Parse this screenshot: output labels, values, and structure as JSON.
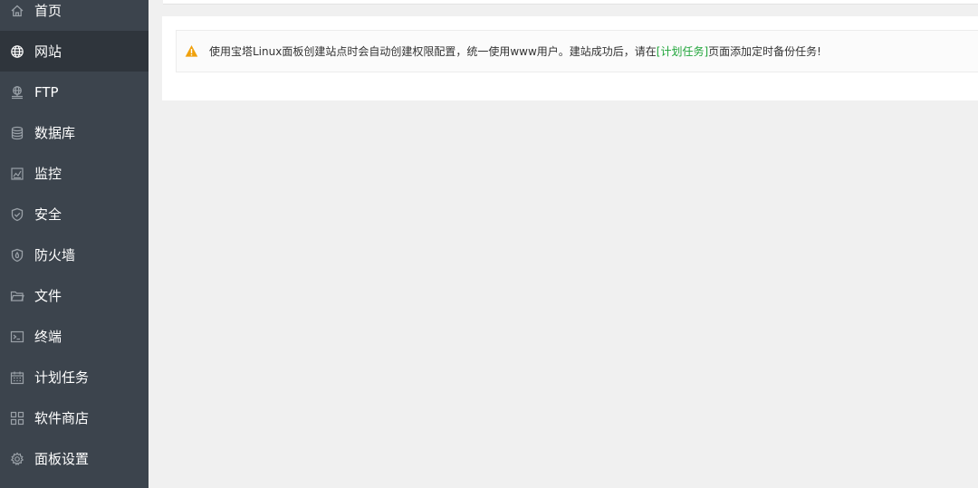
{
  "colors": {
    "sidebar_bg": "#3c444d",
    "sidebar_active_bg": "#2f353c",
    "link_green": "#20a53a",
    "warning_orange": "#f0a10c"
  },
  "sidebar": {
    "items": [
      {
        "label": "首页",
        "icon": "home-icon",
        "active": false
      },
      {
        "label": "网站",
        "icon": "globe-icon",
        "active": true
      },
      {
        "label": "FTP",
        "icon": "ftp-icon",
        "active": false
      },
      {
        "label": "数据库",
        "icon": "database-icon",
        "active": false
      },
      {
        "label": "监控",
        "icon": "monitor-icon",
        "active": false
      },
      {
        "label": "安全",
        "icon": "shield-icon",
        "active": false
      },
      {
        "label": "防火墙",
        "icon": "firewall-icon",
        "active": false
      },
      {
        "label": "文件",
        "icon": "folder-icon",
        "active": false
      },
      {
        "label": "终端",
        "icon": "terminal-icon",
        "active": false
      },
      {
        "label": "计划任务",
        "icon": "calendar-icon",
        "active": false
      },
      {
        "label": "软件商店",
        "icon": "grid-icon",
        "active": false
      },
      {
        "label": "面板设置",
        "icon": "gear-icon",
        "active": false
      }
    ]
  },
  "notice": {
    "icon": "warning-icon",
    "text_before": "使用宝塔Linux面板创建站点时会自动创建权限配置，统一使用www用户。建站成功后，请在",
    "link_text": "[计划任务]",
    "text_after": "页面添加定时备份任务!"
  }
}
